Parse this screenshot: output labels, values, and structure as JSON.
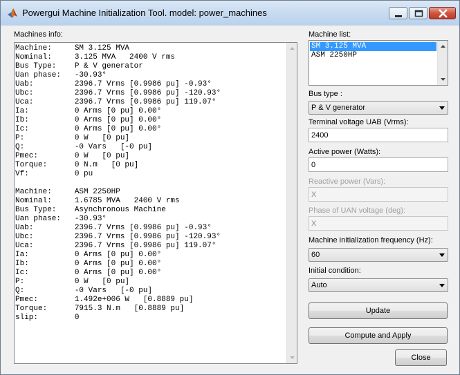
{
  "window": {
    "title": "Powergui Machine Initialization Tool.  model: power_machines"
  },
  "machines_info": {
    "label": "Machines info:",
    "lines": [
      "Machine:     SM 3.125 MVA",
      "Nominal:     3.125 MVA   2400 V rms",
      "Bus Type:    P & V generator",
      "Uan phase:   -30.93°",
      "Uab:         2396.7 Vrms [0.9986 pu] -0.93°",
      "Ubc:         2396.7 Vrms [0.9986 pu] -120.93°",
      "Uca:         2396.7 Vrms [0.9986 pu] 119.07°",
      "Ia:          0 Arms [0 pu] 0.00°",
      "Ib:          0 Arms [0 pu] 0.00°",
      "Ic:          0 Arms [0 pu] 0.00°",
      "P:           0 W   [0 pu]",
      "Q:           -0 Vars   [-0 pu]",
      "Pmec:        0 W   [0 pu]",
      "Torque:      0 N.m   [0 pu]",
      "Vf:          0 pu",
      "",
      "Machine:     ASM 2250HP",
      "Nominal:     1.6785 MVA   2400 V rms",
      "Bus Type:    Asynchronous Machine",
      "Uan phase:   -30.93°",
      "Uab:         2396.7 Vrms [0.9986 pu] -0.93°",
      "Ubc:         2396.7 Vrms [0.9986 pu] -120.93°",
      "Uca:         2396.7 Vrms [0.9986 pu] 119.07°",
      "Ia:          0 Arms [0 pu] 0.00°",
      "Ib:          0 Arms [0 pu] 0.00°",
      "Ic:          0 Arms [0 pu] 0.00°",
      "P:           0 W   [0 pu]",
      "Q:           -0 Vars   [-0 pu]",
      "Pmec:        1.492e+006 W   [0.8889 pu]",
      "Torque:      7915.3 N.m   [0.8889 pu]",
      "slip:        0"
    ]
  },
  "machine_list": {
    "label": "Machine list:",
    "items": [
      "SM 3.125 MVA",
      "ASM 2250HP"
    ],
    "selected_index": 0
  },
  "bus_type": {
    "label": "Bus type :",
    "value": "P & V generator"
  },
  "terminal_voltage": {
    "label": "Terminal voltage UAB (Vrms):",
    "value": "2400"
  },
  "active_power": {
    "label": "Active power (Watts):",
    "value": "0"
  },
  "reactive_power": {
    "label": "Reactive power (Vars):",
    "value": "X",
    "enabled": false
  },
  "phase_uan": {
    "label": "Phase of UAN voltage (deg):",
    "value": "X",
    "enabled": false
  },
  "init_frequency": {
    "label": "Machine initialization frequency (Hz):",
    "value": "60"
  },
  "initial_condition": {
    "label": "Initial condition:",
    "value": "Auto"
  },
  "buttons": {
    "update": "Update",
    "compute_apply": "Compute and Apply",
    "close": "Close"
  },
  "colors": {
    "selection": "#3399ff",
    "disabled_text": "#a0a0a0"
  }
}
